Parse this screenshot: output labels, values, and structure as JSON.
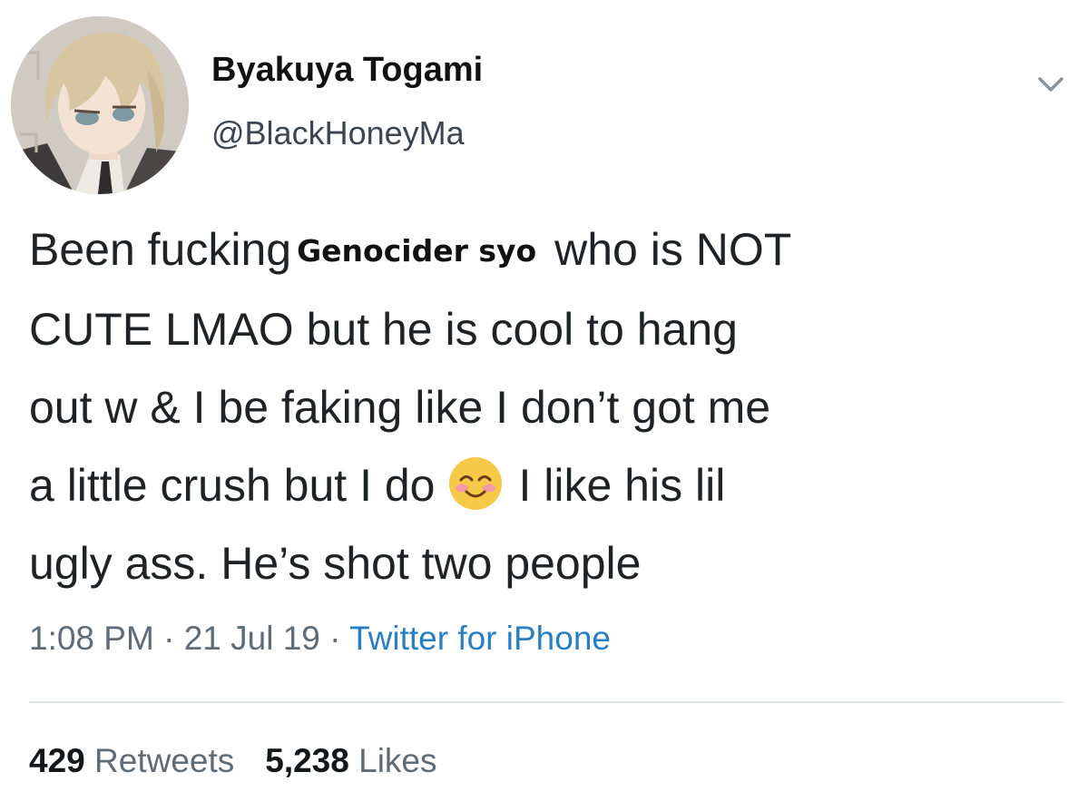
{
  "user": {
    "display_name": "Byakuya Togami",
    "handle": "@BlackHoneyMa",
    "avatar_icon": "anime-avatar"
  },
  "menu": {
    "icon": "chevron-down-icon"
  },
  "tweet": {
    "line1_pre": "Been fucking",
    "line1_name": "Genocider syo",
    "line1_post": "who is NOT",
    "line2": "CUTE LMAO but he is cool to hang",
    "line3": "out w & I be faking like I don’t got me",
    "line4_pre": "a little crush but I do",
    "line4_emoji": "smiling-face-with-smiling-eyes",
    "line4_post": "I like his lil",
    "line5": "ugly ass. He’s shot two people"
  },
  "meta": {
    "time": "1:08 PM",
    "sep1": " · ",
    "date": "21 Jul 19",
    "sep2": " · ",
    "source": "Twitter for iPhone"
  },
  "stats": {
    "retweets_count": "429",
    "retweets_label": "Retweets",
    "likes_count": "5,238",
    "likes_label": "Likes"
  },
  "colors": {
    "link": "#2a7fc3",
    "text": "#1f2326",
    "muted": "#5f6b75",
    "divider": "#e3e6e8"
  }
}
